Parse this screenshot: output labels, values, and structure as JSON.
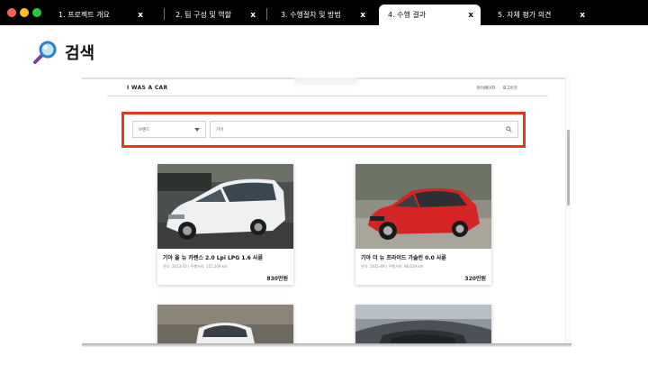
{
  "tabs": [
    {
      "label": "1. 프로젝트 개요",
      "close": "x"
    },
    {
      "label": "2. 팀 구성 및 역할",
      "close": "x"
    },
    {
      "label": "3. 수행절차 및 방법",
      "close": "x"
    },
    {
      "label": "4. 수행 결과",
      "close": "x"
    },
    {
      "label": "5. 자체 평가 의견",
      "close": "x"
    }
  ],
  "active_tab_index": 3,
  "section": {
    "icon": "magnifier-icon",
    "title": "검색"
  },
  "site": {
    "brand": "I WAS A CAR",
    "nav": [
      "마이페이지",
      "로그아웃"
    ],
    "brand_select": "브랜드",
    "search_value": "기아",
    "search_icon": "search-icon"
  },
  "cards": [
    {
      "title": "기아 올 뉴 카렌스 2.0 Lpi LPG 1.6 사륜",
      "meta": "연식: 2013-10 | 주행거리: 115,209 km",
      "price": "830만원"
    },
    {
      "title": "기아 더 뉴 프라이드 가솔린 0.0 사륜",
      "meta": "연식: 2011-09 | 주행거리: 96,019 km",
      "price": "320만원"
    }
  ],
  "colors": {
    "highlight": "#e8361b",
    "topbar": "#000000",
    "dot_red": "#ff5f56",
    "dot_yellow": "#ffbd2e",
    "dot_green": "#27c93f"
  }
}
